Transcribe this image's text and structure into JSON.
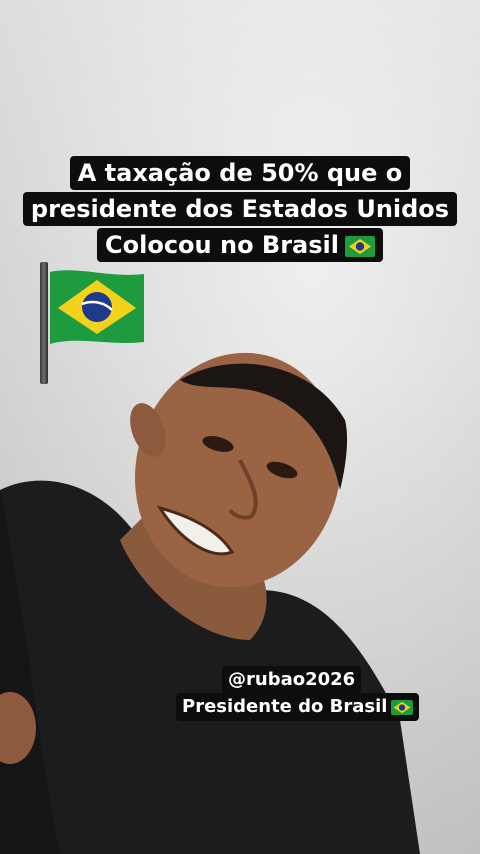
{
  "overlay_top": {
    "line1": "A taxação de 50% que o",
    "line2": "presidente dos Estados Unidos",
    "line3": "Colocou no Brasil"
  },
  "overlay_bottom": {
    "handle": "@rubao2026",
    "role": "Presidente do Brasil"
  },
  "colors": {
    "flag_green": "#1f9b3f",
    "flag_yellow": "#f4d21c",
    "flag_blue": "#1e3a8a",
    "caption_bg": "#0d0d0d",
    "caption_text": "#ffffff"
  },
  "icons": [
    "brazil-flag-emoji",
    "brazil-flag-on-pole"
  ]
}
